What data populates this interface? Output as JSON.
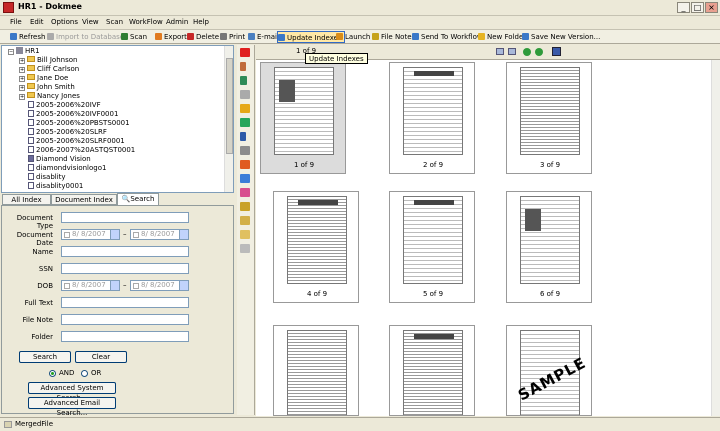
{
  "window": {
    "title": "HR1 - Dokmee",
    "min": "_",
    "max": "□",
    "close": "×"
  },
  "menu": [
    "File",
    "Edit",
    "Options",
    "View",
    "Scan",
    "WorkFlow",
    "Admin",
    "Help"
  ],
  "toolbar": [
    {
      "label": "Refresh",
      "color": "#3a78c8"
    },
    {
      "label": "Import to Database",
      "color": "#9a9a9a",
      "disabled": true
    },
    {
      "label": "Scan",
      "color": "#2e7d32"
    },
    {
      "label": "Export",
      "color": "#e07a1f"
    },
    {
      "label": "Delete",
      "color": "#c62828"
    },
    {
      "label": "Print",
      "color": "#777"
    },
    {
      "label": "E-mail",
      "color": "#4a7fc0"
    },
    {
      "label": "Update Indexes",
      "color": "#3a78c8",
      "highlight": true
    },
    {
      "label": "Launch",
      "color": "#d98d1a"
    },
    {
      "label": "File Notes",
      "color": "#c6a21a"
    },
    {
      "label": "Send To Workflow",
      "color": "#3a78c8"
    },
    {
      "label": "New Folder",
      "color": "#e6b422"
    },
    {
      "label": "Save New Version...",
      "color": "#3a78c8"
    }
  ],
  "tree": {
    "root": "HR1",
    "folders": [
      "Bill Johnson",
      "Cliff Carlson",
      "Jane Doe",
      "John Smith",
      "Nancy Jones"
    ],
    "files": [
      "2005-2006%20IVF",
      "2005-2006%20IVF0001",
      "2005-2006%20PBSTS0001",
      "2005-2006%20SLRF",
      "2005-2006%20SLRF0001",
      "2006-2007%20ASTQST0001",
      "Diamond Vision",
      "diamondvisionlogo1",
      "disablity",
      "disablity0001"
    ]
  },
  "tabs": [
    "All Index Fields",
    "Document Index Fields",
    "Search"
  ],
  "search": {
    "fields": [
      "Document Type",
      "Document Date",
      "Name",
      "SSN",
      "DOB",
      "Full Text",
      "File Note",
      "Folder"
    ],
    "date_value": "8/ 8/2007",
    "dash": "–",
    "search_btn": "Search",
    "clear_btn": "Clear",
    "and_label": "AND",
    "or_label": "OR",
    "adv_system": "Advanced System Search...",
    "adv_email": "Advanced Email Search..."
  },
  "viewer": {
    "page_indicator": "1 of 9",
    "tooltip": "Update Indexes",
    "thumbs": [
      "1 of 9",
      "2 of 9",
      "3 of 9",
      "4 of 9",
      "5 of 9",
      "6 of 9",
      "",
      "",
      ""
    ],
    "sample_text": "SAMPLE"
  },
  "status": {
    "text": "MergedFile"
  }
}
